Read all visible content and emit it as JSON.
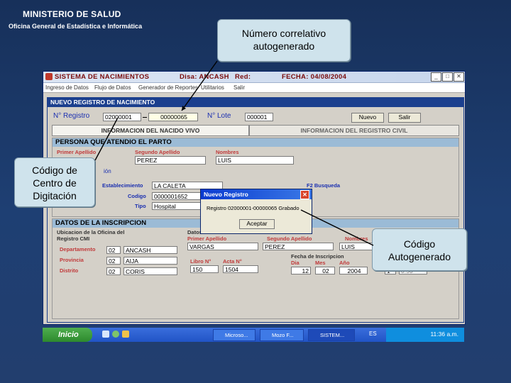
{
  "header": {
    "ministry": "MINISTERIO DE SALUD",
    "office": "Oficina General de Estadística e Informática"
  },
  "callouts": {
    "correlativo": "Número correlativo autogenerado",
    "centro": "Código de Centro de Digitación",
    "autogen": "Código Autogenerado"
  },
  "window": {
    "title": "SISTEMA DE NACIMIENTOS",
    "disa": "Disa: ANCASH",
    "red": "Red:",
    "fecha": "FECHA: 04/08/2004",
    "menu": [
      "Ingreso de Datos",
      "Flujo de Datos",
      "Generador de Reportes",
      "Utilitarios",
      "Salir"
    ]
  },
  "form": {
    "header": "NUEVO REGISTRO DE NACIMIENTO",
    "nro_registro_label": "N° Registro",
    "centro_code": "02000001",
    "correlativo": "00000065",
    "nro_lote_label": "N° Lote",
    "lote": "000001",
    "nuevo_button": "Nuevo",
    "salir_button": "Salir",
    "tab_nacido": "INFORMACION DEL NACIDO VIVO",
    "tab_registro": "INFORMACION DEL REGISTRO CIVIL",
    "persona_band": "PERSONA QUE ATENDIO EL PARTO",
    "primer_apellido_label": "Primer Apellido",
    "segundo_apellido_label": "Segundo Apellido",
    "nombres_label": "Nombres",
    "segundo_apellido": "PEREZ",
    "nombres": "LUIS",
    "ion_label": "ión",
    "establecimiento_label": "Establecimiento",
    "establecimiento": "LA CALETA",
    "codigo_label": "Codigo",
    "codigo": "0000001652",
    "tipo_label": "Tipo",
    "tipo": "Hospital",
    "busqueda": "F2 Busqueda",
    "inscripcion_band": "DATOS DE LA INSCRIPCION",
    "ubicacion_label": "Ubicacion de la Oficina del Registro CMI",
    "departamento_label": "Departamento",
    "departamento_code": "02",
    "departamento": "ANCASH",
    "provincia_label": "Provincia",
    "provincia_code": "02",
    "provincia": "AIJA",
    "distrito_label": "Distrito",
    "distrito_code": "02",
    "distrito": "CORIS",
    "datos_label": "Datos",
    "primer_apellido2_label": "Primer Apellido",
    "segundo_apellido2_label": "Segundo Apellido",
    "nombres2_label": "Nombres",
    "apellido1": "VARGAS",
    "apellido2": "PEREZ",
    "nombre2": "LUIS",
    "libro_label": "Libro N°",
    "acta_label": "Acta N°",
    "libro": "150",
    "acta": "1504",
    "fecha_insc_label": "Fecha de Inscripcion",
    "dia_label": "Dia",
    "mes_label": "Mes",
    "ano_label": "Año",
    "dia": "12",
    "mes": "02",
    "ano": "2004",
    "extra": "1",
    "extra2": "0.50"
  },
  "dialog": {
    "title": "Nuevo Registro",
    "message": "Registro 02000001-00000065 Grabado",
    "ok_button": "Aceptar"
  },
  "taskbar": {
    "start": "Inicio",
    "tasks": [
      "Microso...",
      "Mozo F...",
      "SISTEM...",
      "ES"
    ],
    "clock": "11:36 a.m."
  }
}
